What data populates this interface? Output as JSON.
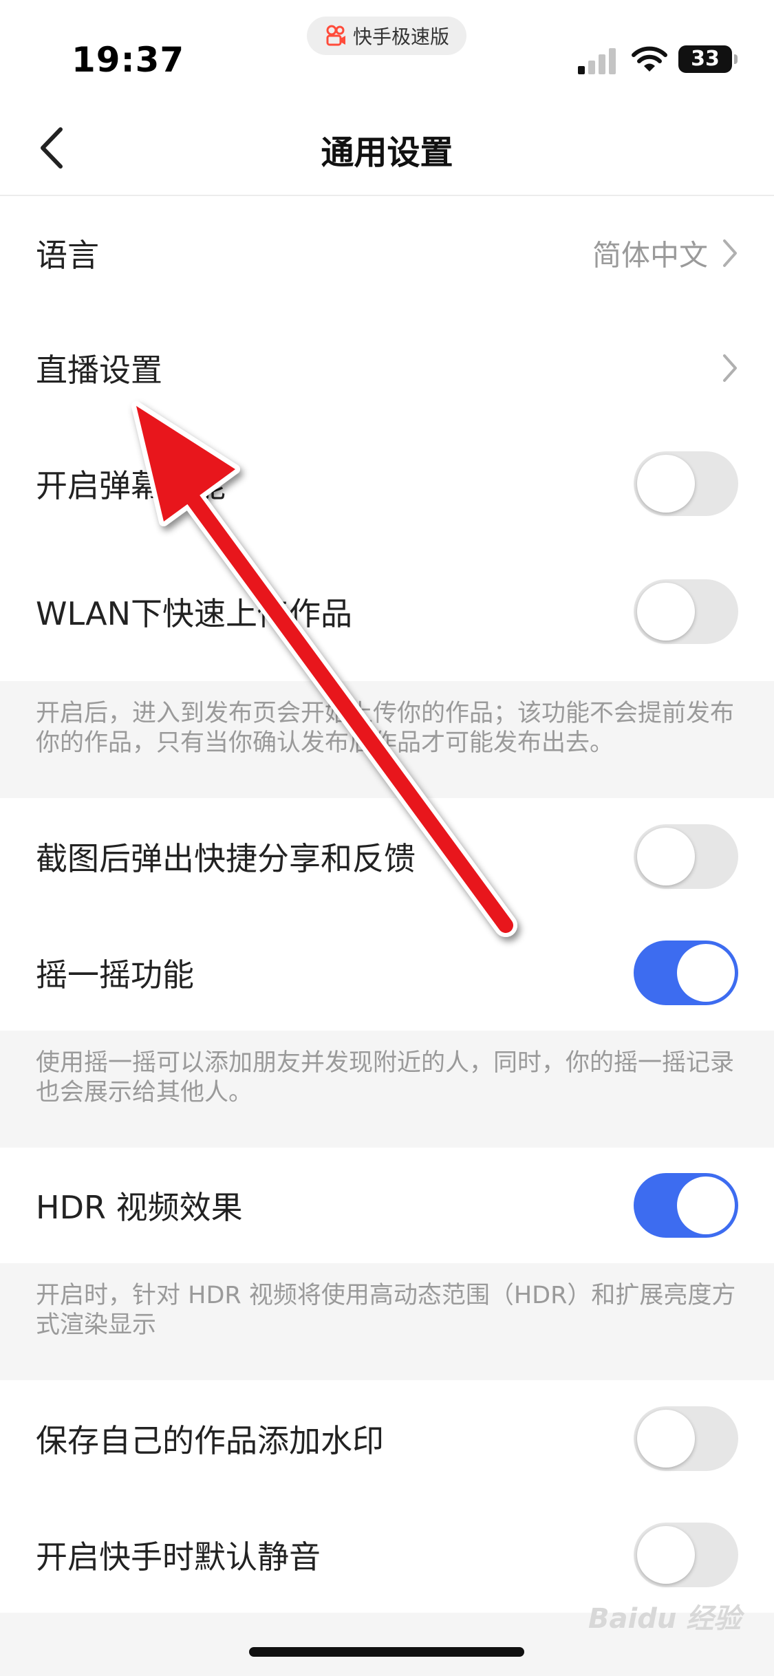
{
  "status_bar": {
    "time": "19:37",
    "app_pill_label": "快手极速版",
    "battery": "33"
  },
  "nav": {
    "title": "通用设置"
  },
  "settings": [
    {
      "label": "语言",
      "value": "简体中文",
      "type": "link"
    },
    {
      "label": "直播设置",
      "type": "link"
    },
    {
      "label": "开启弹幕功能",
      "type": "toggle",
      "on": false
    },
    {
      "label": "WLAN下快速上传作品",
      "type": "toggle",
      "on": false,
      "note": "开启后，进入到发布页会开始上传你的作品；该功能不会提前发布你的作品，只有当你确认发布后作品才可能发布出去。"
    },
    {
      "label": "截图后弹出快捷分享和反馈",
      "type": "toggle",
      "on": false
    },
    {
      "label": "摇一摇功能",
      "type": "toggle",
      "on": true,
      "note": "使用摇一摇可以添加朋友并发现附近的人，同时，你的摇一摇记录也会展示给其他人。"
    },
    {
      "label": "HDR 视频效果",
      "type": "toggle",
      "on": true,
      "note": "开启时，针对 HDR 视频将使用高动态范围（HDR）和扩展亮度方式渲染显示"
    },
    {
      "label": "保存自己的作品添加水印",
      "type": "toggle",
      "on": false
    },
    {
      "label": "开启快手时默认静音",
      "type": "toggle",
      "on": false
    }
  ],
  "watermark": "Baidu 经验",
  "colors": {
    "toggle_on": "#3d6cf0",
    "toggle_off": "#e6e6e6",
    "annotation_arrow": "#e8141b"
  }
}
